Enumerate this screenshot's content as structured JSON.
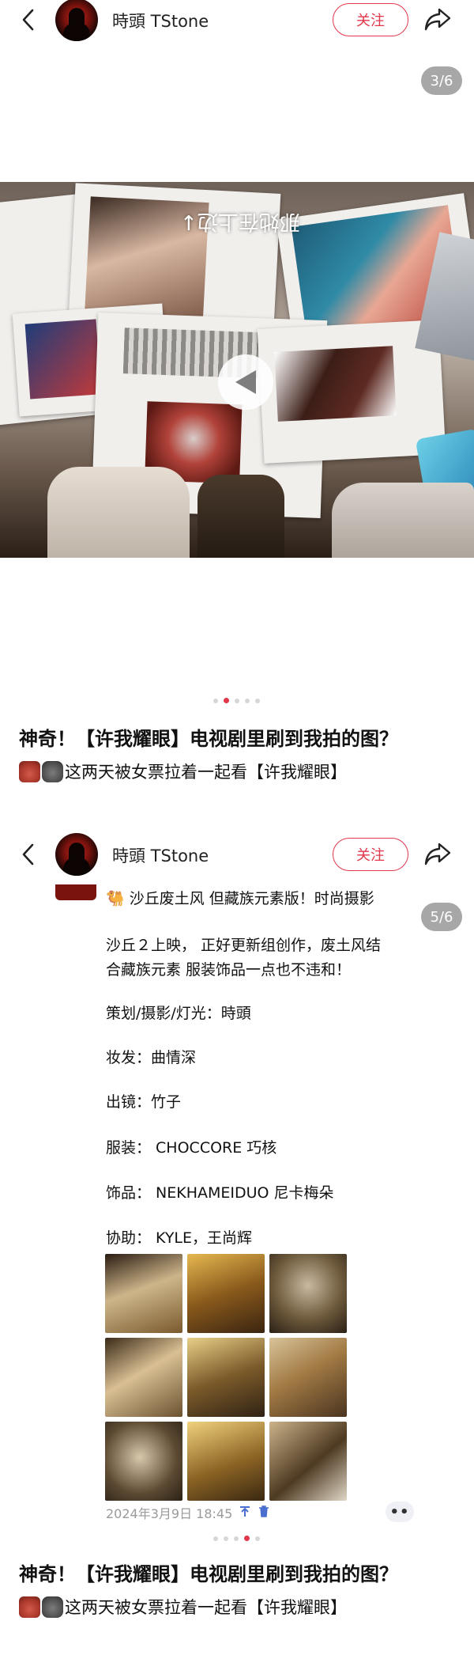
{
  "post1": {
    "header": {
      "username": "時頭 TStone",
      "follow_label": "关注"
    },
    "counter": "3/6",
    "overlay_text": "那她在上边↓",
    "title": "神奇！【许我耀眼】电视剧里刷到我拍的图？",
    "desc": "这两天被女票拉着一起看【许我耀眼】",
    "dots": {
      "count": 5,
      "active": 1
    }
  },
  "post2": {
    "header": {
      "username": "時頭 TStone",
      "follow_label": "关注"
    },
    "counter": "5/6",
    "lines": [
      "🐫 沙丘废土风 但藏族元素版！时尚摄影",
      "沙丘２上映，  正好更新组创作，废土风结",
      "合藏族元素 服装饰品一点也不违和！",
      "策划/摄影/灯光：時頭",
      "妆发：曲情深",
      "出镜：竹子",
      "服装：  CHOCCORE 巧核",
      "饰品：  NEKHAMEIDUO 尼卡梅朵",
      "协助：  KYLE，王尚辉"
    ],
    "timestamp": "2024年3月9日 18:45",
    "more_label": "••",
    "title": "神奇！【许我耀眼】电视剧里刷到我拍的图？",
    "desc": "这两天被女票拉着一起看【许我耀眼】",
    "dots": {
      "count": 5,
      "active": 3
    }
  },
  "colors": {
    "accent": "#e2364b",
    "text": "#111111",
    "muted": "#9a9a9a"
  },
  "icons": [
    "back-arrow-icon",
    "share-icon",
    "play-icon",
    "pin-icon",
    "trash-icon",
    "more-icon"
  ]
}
